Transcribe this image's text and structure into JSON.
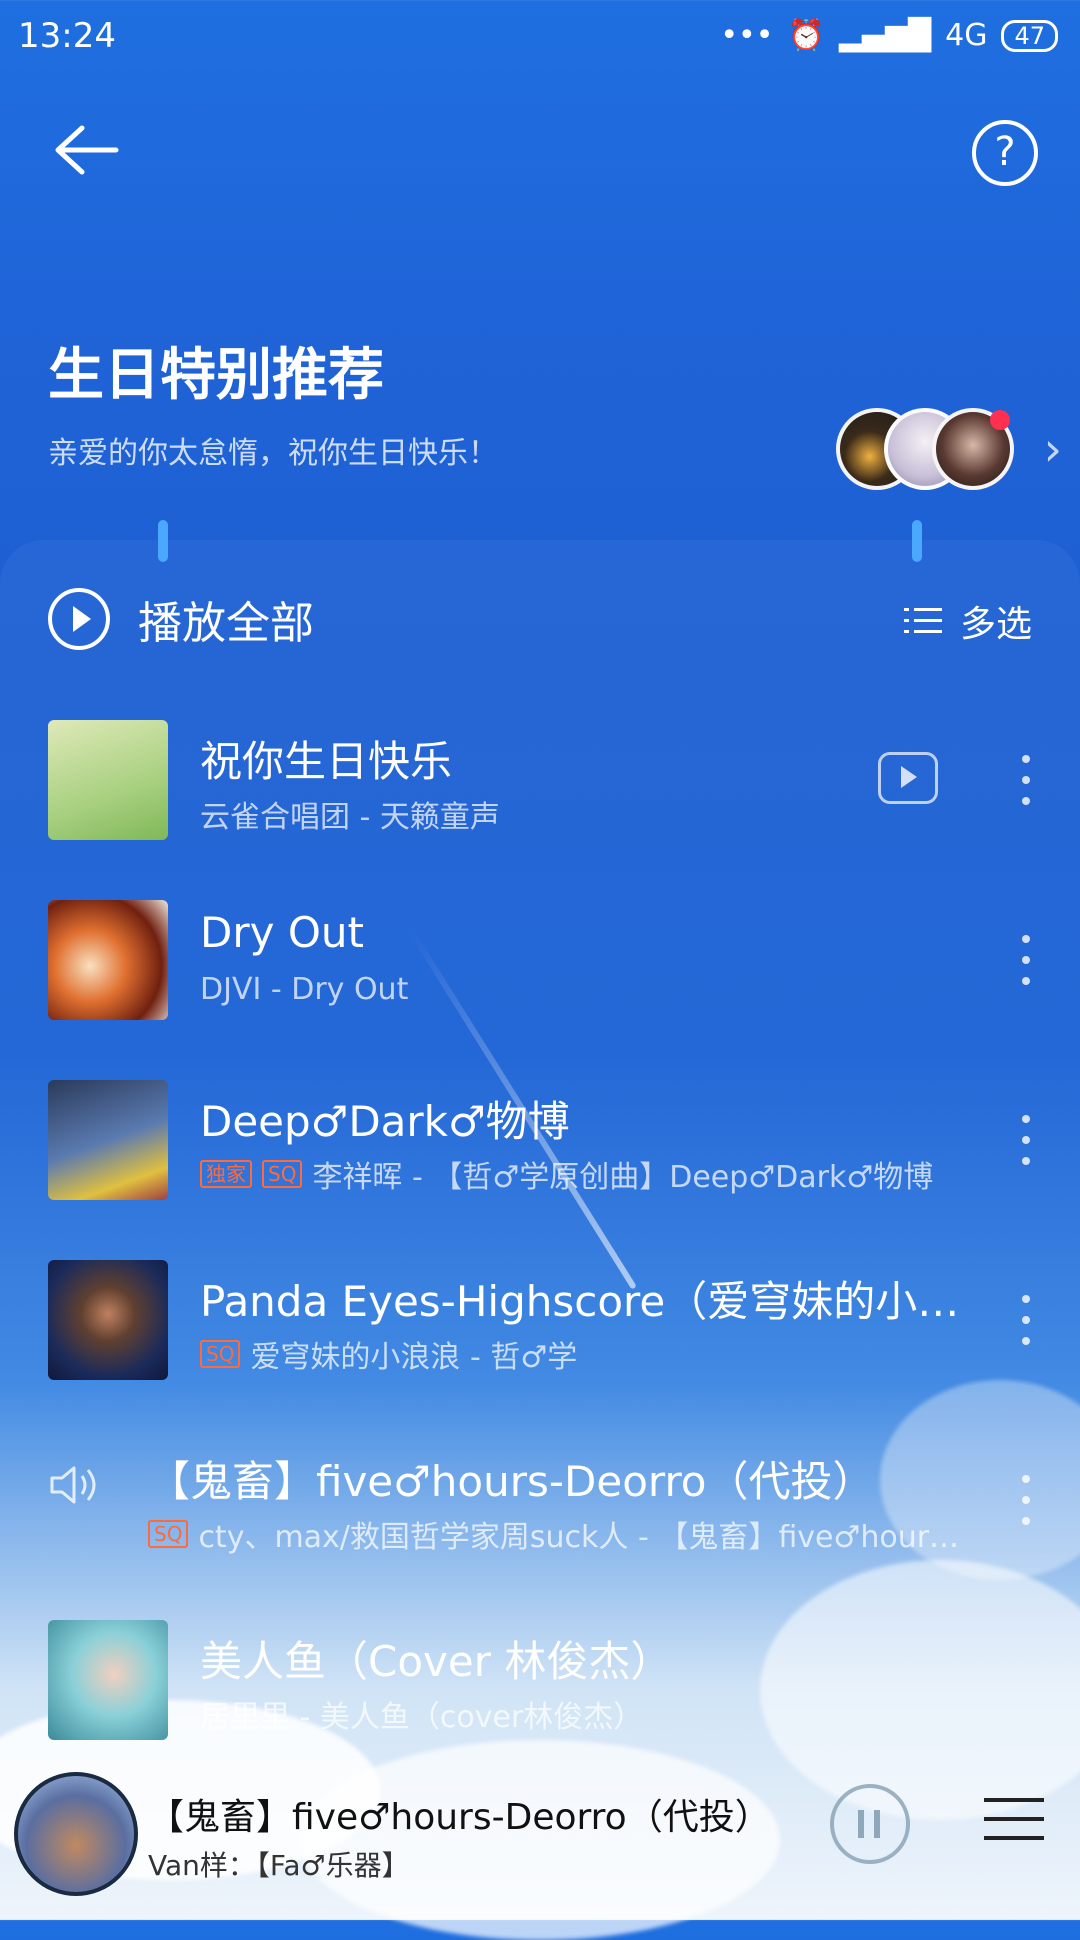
{
  "status_bar": {
    "time": "13:24",
    "dots": "•••",
    "network": "4G",
    "battery": "47"
  },
  "header": {
    "back_icon": "arrow-left-icon",
    "help_label": "?"
  },
  "hero": {
    "title": "生日特别推荐",
    "subtitle": "亲爱的你太怠惰，祝你生日快乐！",
    "more_chevron": "›"
  },
  "toolbar": {
    "play_all": "播放全部",
    "multi_select": "多选"
  },
  "songs": [
    {
      "title": "祝你生日快乐",
      "meta": "云雀合唱团 - 天籁童声",
      "tags": [],
      "has_mv": true,
      "cover_color": "#b8d890"
    },
    {
      "title": "Dry Out",
      "meta": "DJVI - Dry Out",
      "tags": [],
      "has_mv": false,
      "cover_color": "#d06030"
    },
    {
      "title": "Deep♂Dark♂物博",
      "meta": "李祥晖 - 【哲♂学原创曲】Deep♂Dark♂物博",
      "tags": [
        "独家",
        "SQ"
      ],
      "has_mv": false,
      "cover_color": "#3a5a8a"
    },
    {
      "title": "Panda Eyes-Highscore（爱穹妹的小…",
      "meta": "爱穹妹的小浪浪 - 哲♂学",
      "tags": [
        "SQ"
      ],
      "has_mv": false,
      "cover_color": "#2a3a6a"
    },
    {
      "title": "【鬼畜】five♂hours-Deorro（代投）",
      "meta": "cty、max/救国哲学家周suck人 - 【鬼畜】five♂hour…",
      "tags": [
        "SQ"
      ],
      "has_mv": false,
      "playing": true
    },
    {
      "title": "美人鱼（Cover 林俊杰）",
      "meta": "居里里 - 美人鱼（cover林俊杰）",
      "tags": [],
      "has_mv": false,
      "cover_color": "#8ad0d8"
    }
  ],
  "mini_player": {
    "title": "【鬼畜】five♂hours-Deorro（代投）",
    "subtitle": "Van样：【Fa♂乐器】"
  }
}
